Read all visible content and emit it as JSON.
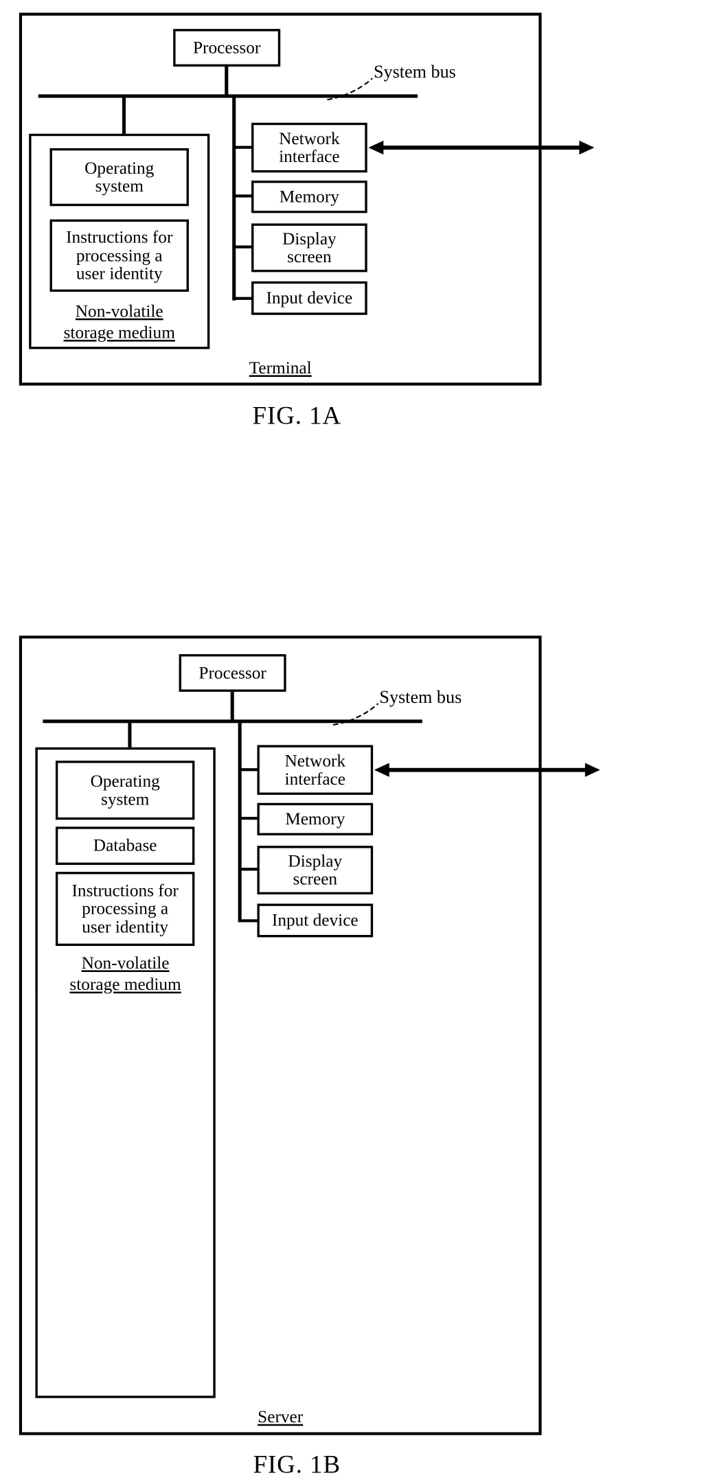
{
  "document": {
    "type": "patent-figure-sheet",
    "figures": [
      {
        "id": "fig-1a",
        "caption": "FIG. 1A",
        "device_label": "Terminal",
        "bus_label": "System bus",
        "processor_label": "Processor",
        "storage_label_line1": "Non-volatile",
        "storage_label_line2": "storage medium",
        "storage_children": [
          {
            "id": "operating-system",
            "line1": "Operating",
            "line2": "system"
          },
          {
            "id": "instructions",
            "line1": "Instructions for",
            "line2": "processing a",
            "line3": "user identity"
          }
        ],
        "peripherals": [
          {
            "id": "network-interface",
            "line1": "Network",
            "line2": "interface",
            "has_external_link": true
          },
          {
            "id": "memory",
            "line1": "Memory",
            "line2": "",
            "has_external_link": false
          },
          {
            "id": "display-screen",
            "line1": "Display",
            "line2": "screen",
            "has_external_link": false
          },
          {
            "id": "input-device",
            "line1": "Input device",
            "line2": "",
            "has_external_link": false
          }
        ]
      },
      {
        "id": "fig-1b",
        "caption": "FIG. 1B",
        "device_label": "Server",
        "bus_label": "System bus",
        "processor_label": "Processor",
        "storage_label_line1": "Non-volatile",
        "storage_label_line2": "storage medium",
        "storage_children": [
          {
            "id": "operating-system",
            "line1": "Operating",
            "line2": "system"
          },
          {
            "id": "database",
            "line1": "Database",
            "line2": ""
          },
          {
            "id": "instructions",
            "line1": "Instructions for",
            "line2": "processing a",
            "line3": "user identity"
          }
        ],
        "peripherals": [
          {
            "id": "network-interface",
            "line1": "Network",
            "line2": "interface",
            "has_external_link": true
          },
          {
            "id": "memory",
            "line1": "Memory",
            "line2": "",
            "has_external_link": false
          },
          {
            "id": "display-screen",
            "line1": "Display",
            "line2": "screen",
            "has_external_link": false
          },
          {
            "id": "input-device",
            "line1": "Input device",
            "line2": "",
            "has_external_link": false
          }
        ]
      }
    ],
    "colors": {
      "ink": "#000000",
      "paper": "#ffffff"
    }
  }
}
